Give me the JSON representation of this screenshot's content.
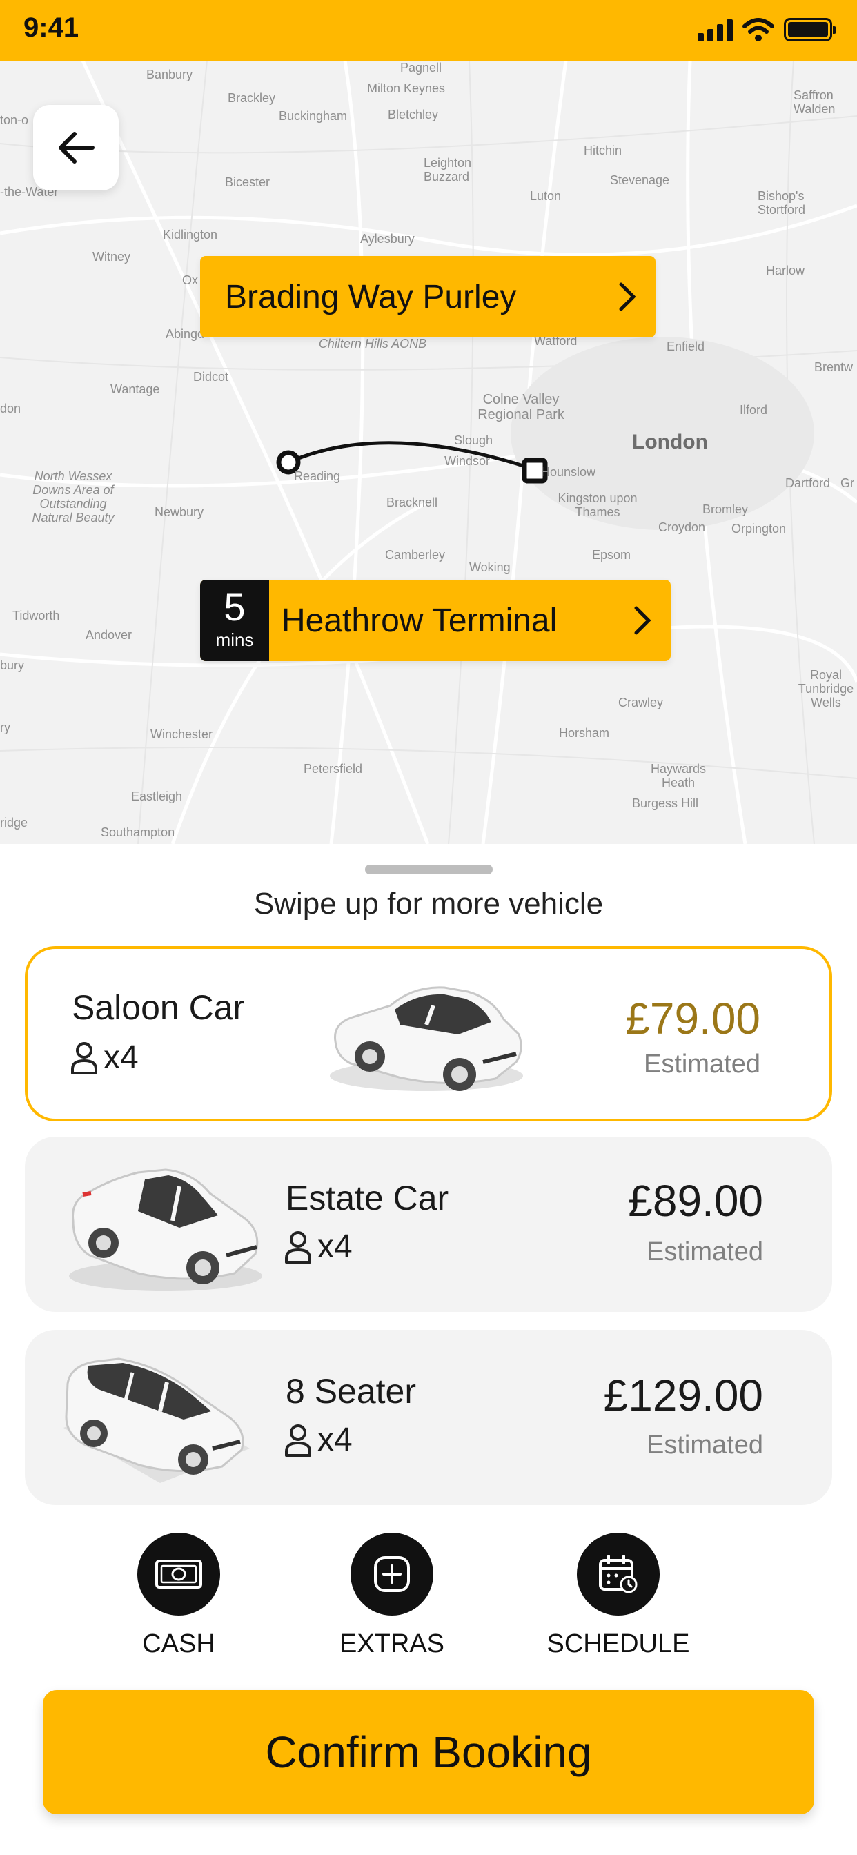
{
  "status_bar": {
    "time": "9:41"
  },
  "map": {
    "labels": {
      "banbury": "Banbury",
      "pagnell": "Pagnell",
      "milton_keynes": "Milton Keynes",
      "brackley": "Brackley",
      "buckingham": "Buckingham",
      "bletchley": "Bletchley",
      "saffron_walden": "Saffron Walden",
      "hitchin": "Hitchin",
      "leighton_buzzard": "Leighton Buzzard",
      "stevenage": "Stevenage",
      "bicester": "Bicester",
      "luton": "Luton",
      "bishops_stortford": "Bishop's Stortford",
      "kidlington": "Kidlington",
      "aylesbury": "Aylesbury",
      "witney": "Witney",
      "harlow": "Harlow",
      "ox": "Ox",
      "abingdon": "Abingd",
      "watford": "Watford",
      "enfield": "Enfield",
      "chiltern": "Chiltern Hills AONB",
      "wantage": "Wantage",
      "didcot": "Didcot",
      "brentw": "Brentw",
      "colne_valley": "Colne Valley Regional Park",
      "ilford": "Ilford",
      "london": "London",
      "slough": "Slough",
      "windsor": "Windsor",
      "reading": "Reading",
      "hounslow": "Hounslow",
      "north_wessex": "North Wessex Downs Area of Outstanding Natural Beauty",
      "newbury": "Newbury",
      "bracknell": "Bracknell",
      "kingston": "Kingston upon Thames",
      "dartford": "Dartford",
      "bromley": "Bromley",
      "croydon": "Croydon",
      "orpington": "Orpington",
      "camberley": "Camberley",
      "epsom": "Epsom",
      "woking": "Woking",
      "tidworth": "Tidworth",
      "andover": "Andover",
      "crawley": "Crawley",
      "royal_tunbridge": "Royal Tunbridge Wells",
      "winchester": "Winchester",
      "horsham": "Horsham",
      "petersfield": "Petersfield",
      "haywards_heath": "Haywards Heath",
      "burgess_hill": "Burgess Hill",
      "eastleigh": "Eastleigh",
      "southampton": "Southampton",
      "ton_water": "-the-Water",
      "gr": "Gr",
      "don": "don",
      "bury": "bury",
      "ry": "ry",
      "ridge": "ridge",
      "ton": "ton-o"
    },
    "pickup": {
      "label": "Brading Way Purley"
    },
    "dropoff": {
      "label": "Heathrow Terminal",
      "eta_value": "5",
      "eta_unit": "mins"
    }
  },
  "sheet": {
    "swipe_hint": "Swipe up for more vehicle",
    "vehicles": [
      {
        "name": "Saloon Car",
        "passengers": "x4",
        "price": "£79.00",
        "price_note": "Estimated",
        "selected": true
      },
      {
        "name": "Estate Car",
        "passengers": "x4",
        "price": "£89.00",
        "price_note": "Estimated",
        "selected": false
      },
      {
        "name": "8 Seater",
        "passengers": "x4",
        "price": "£129.00",
        "price_note": "Estimated",
        "selected": false
      }
    ],
    "actions": [
      {
        "label": "CASH",
        "icon": "cash-icon"
      },
      {
        "label": "EXTRAS",
        "icon": "plus-icon"
      },
      {
        "label": "SCHEDULE",
        "icon": "calendar-icon"
      }
    ],
    "confirm_label": "Confirm Booking"
  },
  "colors": {
    "accent": "#FFB800",
    "selected_price": "#9B7718",
    "dark": "#111111"
  }
}
